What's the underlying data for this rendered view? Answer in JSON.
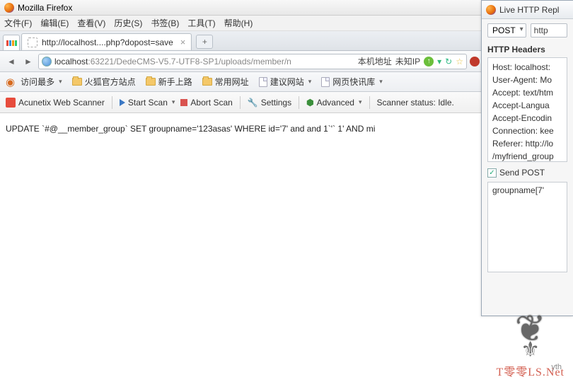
{
  "app_title": "Mozilla Firefox",
  "menubar": [
    "文件(F)",
    "编辑(E)",
    "查看(V)",
    "历史(S)",
    "书签(B)",
    "工具(T)",
    "帮助(H)"
  ],
  "tab": {
    "label": "http://localhost....php?dopost=save"
  },
  "url": {
    "host": "localhost",
    "rest": ":63221/DedeCMS-V5.7-UTF8-SP1/uploads/member/n",
    "badge1": "本机地址",
    "badge2": "未知IP"
  },
  "bookmarks": [
    "访问最多",
    "火狐官方站点",
    "新手上路",
    "常用网址",
    "建议网站",
    "网页快讯库"
  ],
  "toolbar": {
    "acunetix": "Acunetix Web Scanner",
    "start": "Start Scan",
    "abort": "Abort Scan",
    "settings": "Settings",
    "advanced": "Advanced",
    "status": "Scanner status: Idle."
  },
  "page_text": "UPDATE `#@__member_group` SET groupname='123asas' WHERE id='7' and and 1`'` 1' AND mi",
  "side": {
    "title": "Live HTTP Repl",
    "method": "POST",
    "url": "http",
    "headers_title": "HTTP Headers",
    "headers": [
      "Host: localhost:",
      "User-Agent: Mo",
      "Accept: text/htm",
      "Accept-Langua",
      "Accept-Encodin",
      "Connection: kee",
      "Referer: http://lo",
      "/myfriend_group"
    ],
    "send_post": "Send POST",
    "post_body": "groupname[7'",
    "yth": "yth"
  },
  "watermark": "T零零LS.Net"
}
